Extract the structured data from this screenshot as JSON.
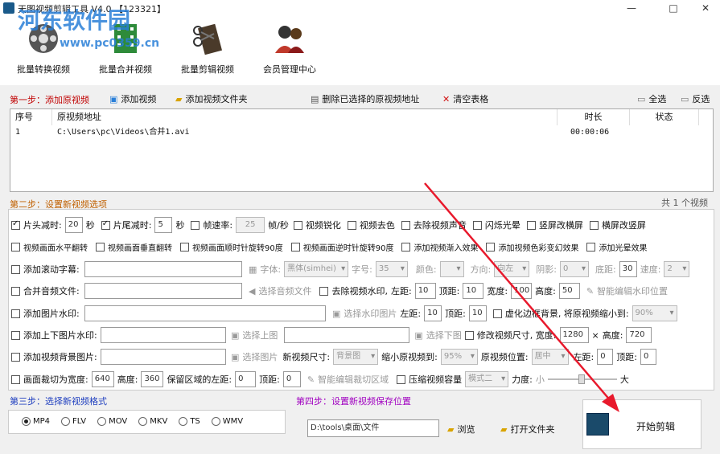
{
  "window": {
    "title": "天图视频剪辑工具 V4.0  【123321】",
    "minimize": "—",
    "maximize": "□",
    "close": "✕"
  },
  "watermark": {
    "line1": "河东软件园",
    "line2": "www.pc0359.cn"
  },
  "toolbar": [
    {
      "label": "批量转换视频",
      "icon": "film-reel-icon"
    },
    {
      "label": "批量合并视频",
      "icon": "film-strip-icon"
    },
    {
      "label": "批量剪辑视频",
      "icon": "scissors-film-icon"
    },
    {
      "label": "会员管理中心",
      "icon": "users-icon"
    }
  ],
  "step1": {
    "label": "第一步：添加原视频",
    "add_video": "添加视频",
    "add_folder": "添加视频文件夹",
    "delete_selected": "删除已选择的原视频地址",
    "clear_table": "清空表格",
    "select_all": "全选",
    "invert": "反选"
  },
  "table": {
    "headers": [
      "序号",
      "原视频地址",
      "时长",
      "状态"
    ],
    "rows": [
      {
        "index": "1",
        "path": "C:\\Users\\pc\\Videos\\合并1.avi",
        "duration": "00:00:06",
        "status": ""
      }
    ],
    "total": "共 1 个视频"
  },
  "step2": {
    "label": "第二步：设置新视频选项",
    "row1": {
      "head_trim": "片头减时:",
      "head_val": "20",
      "sec1": "秒",
      "tail_trim": "片尾减时:",
      "tail_val": "5",
      "sec2": "秒",
      "framerate": "帧速率:",
      "framerate_val": "25",
      "fps_unit": "帧/秒",
      "sharpen": "视频锐化",
      "decolor": "视频去色",
      "remove_audio": "去除视频声音",
      "flash": "闪烁光晕",
      "v2h": "竖屏改横屏",
      "h2v": "横屏改竖屏"
    },
    "row2": [
      "视频画面水平翻转",
      "视频画面垂直翻转",
      "视频画面顺时针旋转90度",
      "视频画面逆时针旋转90度",
      "添加视频渐入效果",
      "添加视频色彩变幻效果",
      "添加光晕效果"
    ],
    "row3": {
      "scroll_text": "添加滚动字幕:",
      "font": "字体:",
      "font_val": "黑体(simhei)",
      "size": "字号:",
      "size_val": "35",
      "color": "颜色:",
      "direction": "方向:",
      "direction_val": "向左",
      "shadow": "阴影:",
      "shadow_val": "0",
      "bottom": "底距:",
      "bottom_val": "30",
      "speed": "速度:",
      "speed_val": "2"
    },
    "row4": {
      "merge_audio": "合并音频文件:",
      "choose_audio": "选择音频文件",
      "remove_watermark": "去除视频水印,",
      "left": "左距:",
      "left_val": "10",
      "top": "顶距:",
      "top_val": "10",
      "width": "宽度:",
      "width_val": "100",
      "height": "高度:",
      "height_val": "50",
      "smart": "智能编辑水印位置"
    },
    "row5": {
      "img_watermark": "添加图片水印:",
      "choose_img": "选择水印图片",
      "left": "左距:",
      "left_val": "10",
      "top": "顶距:",
      "top_val": "10",
      "blur": "虚化边框背景, 将原视频缩小到:",
      "blur_val": "90%"
    },
    "row6": {
      "top_bottom": "添加上下图片水印:",
      "choose_top": "选择上图",
      "choose_bottom": "选择下图",
      "resize": "修改视频尺寸, 宽度:",
      "width_val": "1280",
      "x": "×",
      "height": "高度:",
      "height_val": "720"
    },
    "row7": {
      "bg_img": "添加视频背景图片:",
      "choose_img": "选择图片",
      "new_size": "新视频尺寸:",
      "new_size_val": "背景图",
      "shrink": "缩小原视频到:",
      "shrink_val": "95%",
      "position": "原视频位置:",
      "position_val": "居中",
      "left": "左距:",
      "left_val": "0",
      "top": "顶距:",
      "top_val": "0"
    },
    "row8": {
      "crop": "画面裁切为宽度:",
      "crop_w": "640",
      "height": "高度:",
      "crop_h": "360",
      "keep_left": "保留区域的左距:",
      "left_val": "0",
      "top": "顶距:",
      "top_val": "0",
      "smart_crop": "智能编辑裁切区域",
      "compress": "压缩视频容量",
      "mode_val": "模式二",
      "strength": "力度:",
      "small": "小",
      "big": "大"
    }
  },
  "step3": {
    "label": "第三步：选择新视频格式",
    "formats": [
      "MP4",
      "FLV",
      "MOV",
      "MKV",
      "TS",
      "WMV"
    ],
    "selected": "MP4"
  },
  "step4": {
    "label": "第四步：设置新视频保存位置",
    "path": "D:\\tools\\桌面\\文件",
    "browse": "浏览",
    "open_folder": "打开文件夹"
  },
  "start": {
    "label": "开始剪辑"
  },
  "colors": {
    "step_red": "#c00000",
    "step_blue": "#1f3fbf",
    "step_purple": "#a000c0",
    "arrow": "#e8192c"
  }
}
